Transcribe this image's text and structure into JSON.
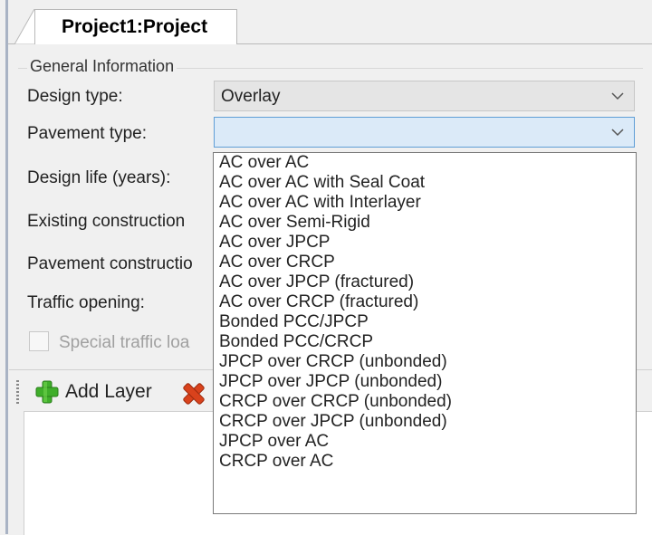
{
  "tab": {
    "label": "Project1:Project"
  },
  "group": {
    "title": "General Information"
  },
  "labels": {
    "design_type": "Design type:",
    "pavement_type": "Pavement type:",
    "design_life": "Design life (years):",
    "existing_construction": "Existing construction",
    "pavement_construction": "Pavement constructio",
    "traffic_opening": "Traffic opening:"
  },
  "design_type": {
    "value": "Overlay"
  },
  "pavement_type": {
    "value": ""
  },
  "dropdown": {
    "options": [
      "AC over AC",
      "AC over AC with Seal Coat",
      "AC over AC with Interlayer",
      "AC over Semi-Rigid",
      "AC over JPCP",
      "AC over CRCP",
      "AC over JPCP (fractured)",
      "AC over CRCP (fractured)",
      "Bonded PCC/JPCP",
      "Bonded PCC/CRCP",
      "JPCP over CRCP (unbonded)",
      "JPCP over JPCP (unbonded)",
      "CRCP over CRCP (unbonded)",
      "CRCP over JPCP (unbonded)",
      "JPCP over AC",
      "CRCP over AC"
    ]
  },
  "checkbox": {
    "label": "Special traffic loa",
    "checked": false
  },
  "toolbar": {
    "add_layer": "Add Layer"
  },
  "icons": {
    "add": "add-layer-icon",
    "delete": "delete-layer-icon",
    "dropdown": "chevron-down-icon"
  },
  "colors": {
    "combo_focus_bg": "#dbeaf8",
    "combo_focus_border": "#5f9ed6",
    "add_green": "#3fae2a",
    "delete_red": "#d9421c"
  }
}
